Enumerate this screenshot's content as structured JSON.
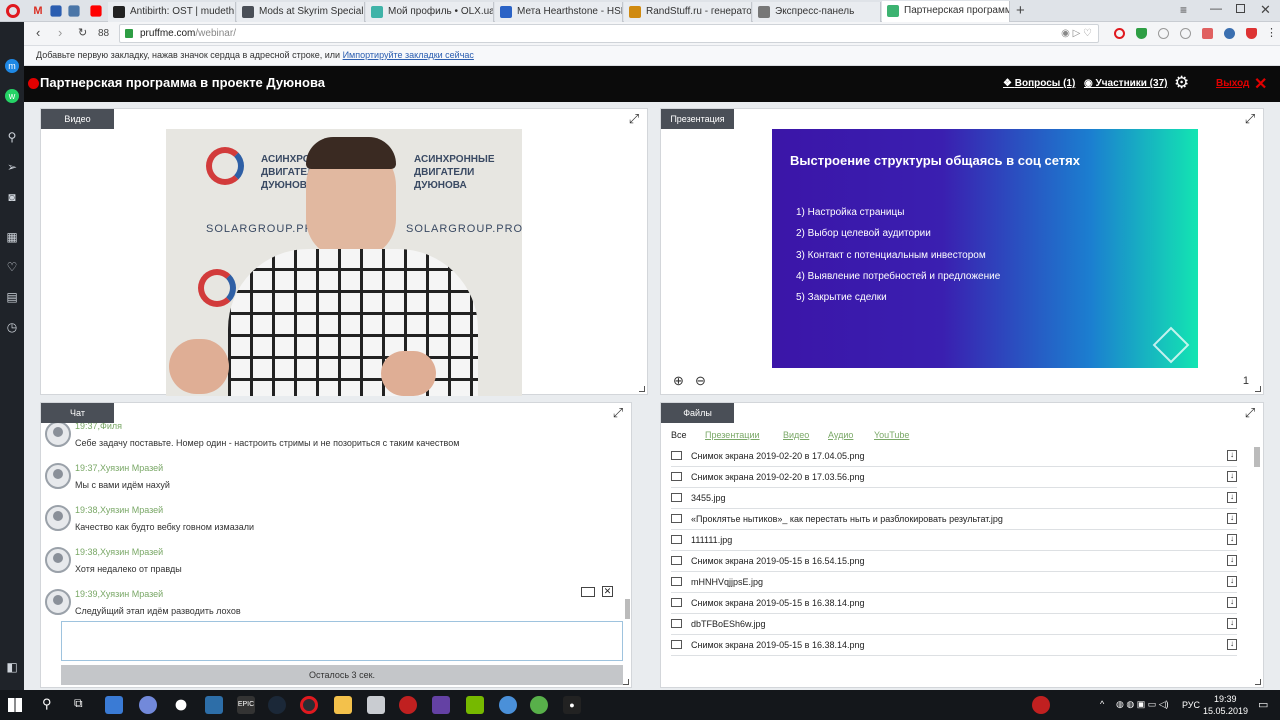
{
  "browser": {
    "tabs": [
      {
        "title": "Antibirth: OST | mudeth",
        "color": "#222"
      },
      {
        "title": "Mods at Skyrim Special Edition",
        "color": "#4a4f57"
      },
      {
        "title": "Мой профиль • OLX.ua",
        "color": "#3fb3a8"
      },
      {
        "title": "Мета Hearthstone - HSReplay",
        "color": "#2b63c6"
      },
      {
        "title": "RandStuff.ru - генератор",
        "color": "#d08a10"
      },
      {
        "title": "Экспресс-панель",
        "color": "#777"
      },
      {
        "title": "Партнерская программа",
        "color": "#3cb371"
      }
    ],
    "url_host": "pruffme.com",
    "url_path": "/webinar/",
    "speed_dial": "88",
    "bookmark_hint": "Добавьте первую закладку, нажав значок сердца в адресной строке, или",
    "bookmark_link": "Импортируйте закладки сейчас"
  },
  "webinar": {
    "title": "Партнерская программа в проекте Дуюнова",
    "questions": "Вопросы (1)",
    "participants": "Участники (37)",
    "exit": "Выход",
    "colors": {
      "header_bg": "#0b0b0b",
      "rec": "#e10000",
      "exit": "#e10000",
      "accent_green": "#7aa867"
    }
  },
  "video_panel": {
    "label": "Видео",
    "backdrop_brand": "АСИНХРОННЫЕ ДВИГАТЕЛИ ДУЮНОВА",
    "backdrop_site": "SOLARGROUP.PRO"
  },
  "presentation_panel": {
    "label": "Презентация",
    "slide_title": "Выстроение структуры общаясь в соц сетях",
    "slide_items": [
      "1) Настройка страницы",
      "2) Выбор целевой аудитории",
      "3) Контакт с потенциальным инвестором",
      "4) Выявление потребностей и предложение",
      "5) Закрытие сделки"
    ],
    "page_number": "1"
  },
  "chat_panel": {
    "label": "Чат",
    "messages": [
      {
        "time": "19:37,",
        "author": "Филя",
        "text": "Себе задачу поставьте. Номер один - настроить стримы и не позориться с таким качеством"
      },
      {
        "time": "19:37,",
        "author": "Хуязин Мразей",
        "text": "Мы с вами идём нахуй"
      },
      {
        "time": "19:38,",
        "author": "Хуязин Мразей",
        "text": "Качество как будто вебку говном измазали"
      },
      {
        "time": "19:38,",
        "author": "Хуязин Мразей",
        "text": "Хотя недалеко от правды"
      },
      {
        "time": "19:39,",
        "author": "Хуязин Мразей",
        "text": "Следуйщий этап идём разводить лохов"
      }
    ],
    "input_value": "",
    "send_status": "Осталось 3 сек."
  },
  "files_panel": {
    "label": "Файлы",
    "filters": [
      "Все",
      "Презентации",
      "Видео",
      "Аудио",
      "YouTube"
    ],
    "files": [
      "Снимок экрана 2019-02-20 в 17.04.05.png",
      "Снимок экрана 2019-02-20 в 17.03.56.png",
      "3455.jpg",
      "«Проклятье нытиков»_ как перестать ныть и разблокировать результат.jpg",
      "111111.jpg",
      "Снимок экрана 2019-05-15 в 16.54.15.png",
      "mHNHVqjjpsE.jpg",
      "Снимок экрана 2019-05-15 в 16.38.14.png",
      "dbTFBoESh6w.jpg",
      "Снимок экрана 2019-05-15 в 16.38.14.png"
    ]
  },
  "taskbar": {
    "lang": "РУС",
    "time": "19:39",
    "date": "15.05.2019"
  }
}
